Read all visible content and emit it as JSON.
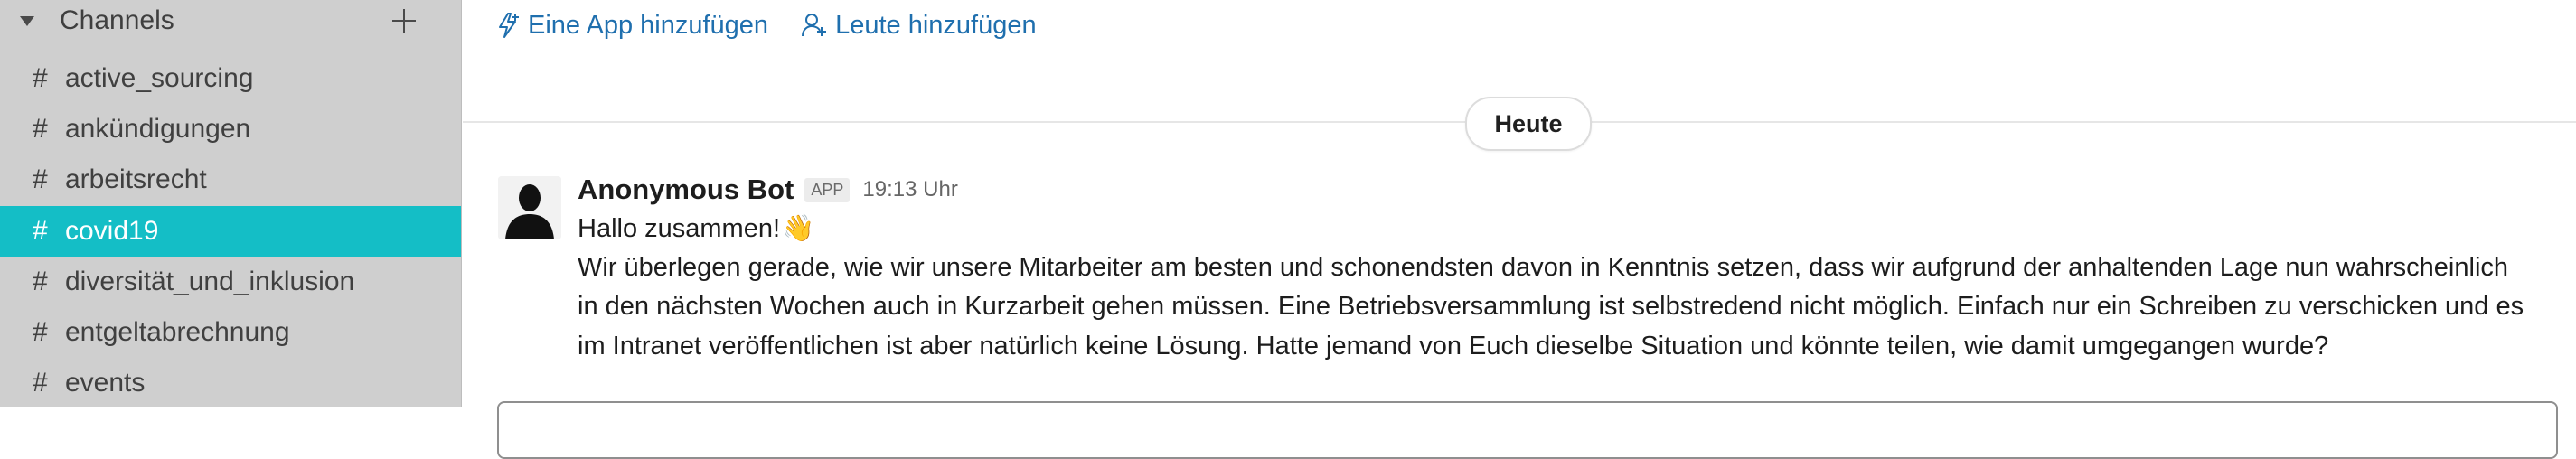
{
  "sidebar": {
    "section_title": "Channels",
    "channels": [
      {
        "hash": "#",
        "name": "active_sourcing",
        "active": false
      },
      {
        "hash": "#",
        "name": "ankündigungen",
        "active": false
      },
      {
        "hash": "#",
        "name": "arbeitsrecht",
        "active": false
      },
      {
        "hash": "#",
        "name": "covid19",
        "active": true
      },
      {
        "hash": "#",
        "name": "diversität_und_inklusion",
        "active": false
      },
      {
        "hash": "#",
        "name": "entgeltabrechnung",
        "active": false
      },
      {
        "hash": "#",
        "name": "events",
        "active": false
      }
    ],
    "active_color": "#14bec6"
  },
  "header": {
    "add_app_label": "Eine App hinzufügen",
    "add_people_label": "Leute hinzufügen",
    "link_color": "#1f6fae"
  },
  "day_divider": {
    "label": "Heute"
  },
  "message": {
    "author": "Anonymous Bot",
    "badge": "APP",
    "time": "19:13 Uhr",
    "greeting": "Hallo zusammen!",
    "emoji": "👋",
    "lines": [
      "Wir überlegen gerade, wie wir unsere Mitarbeiter am besten und schonendsten davon in Kenntnis setzen, dass wir aufgrund der anhaltenden Lage nun wahrscheinlich",
      "in den nächsten Wochen auch in Kurzarbeit gehen müssen. Eine Betriebsversammlung ist selbstredend nicht möglich. Einfach nur ein Schreiben zu verschicken und es",
      "im Intranet veröffentlichen ist aber natürlich keine Lösung. Hatte jemand von Euch dieselbe Situation und könnte teilen, wie damit umgegangen wurde?"
    ]
  }
}
